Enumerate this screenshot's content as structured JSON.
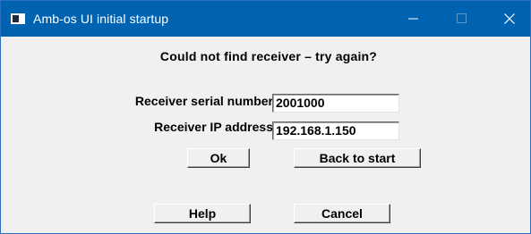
{
  "window": {
    "title": "Amb-os UI initial startup"
  },
  "titlebar_icons": {
    "app": "app-window-icon",
    "minimize": "minimize-icon",
    "maximize": "maximize-icon",
    "close": "close-icon"
  },
  "dialog": {
    "message": "Could not find receiver – try again?",
    "serial_label": "Receiver serial number",
    "serial_value": "2001000",
    "ip_label": "Receiver IP address",
    "ip_value": "192.168.1.150"
  },
  "buttons": {
    "ok": "Ok",
    "back": "Back to start",
    "help": "Help",
    "cancel": "Cancel"
  }
}
